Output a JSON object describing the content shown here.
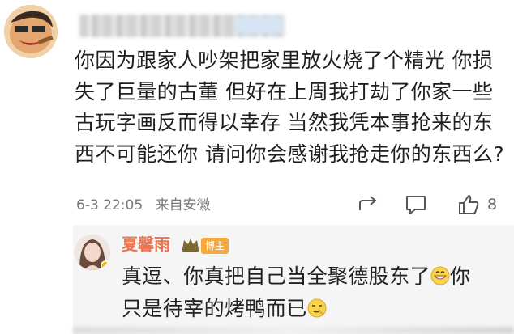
{
  "comment": {
    "text": "你因为跟家人吵架把家里放火烧了个精光 你损失了巨量的古董  但好在上周我打劫了你家一些古玩字画反而得以幸存  当然我凭本事抢来的东西不可能还你   请问你会感谢我抢走你的东西么?",
    "date": "6-3 22:05",
    "source": "来自安徽",
    "like_count": "8"
  },
  "reply": {
    "username": "夏馨雨",
    "badge": "博主",
    "line1": "真逗、你真把自己当全聚德股东了",
    "line2": "只是待宰的烤鸭而已",
    "line1_tail": "你"
  },
  "colors": {
    "username": "#eb7350",
    "badge": "#f4a83d",
    "reply_bg": "#f5f5f5"
  },
  "icons": [
    "share-icon",
    "comment-icon",
    "like-icon",
    "crown-icon",
    "grin-emoji",
    "sly-emoji"
  ]
}
